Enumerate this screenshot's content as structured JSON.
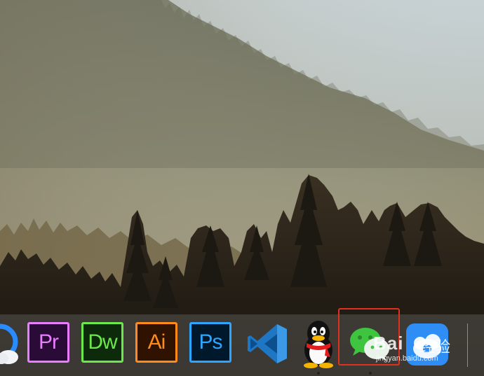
{
  "dock": {
    "apps": [
      {
        "name": "Finder / Cloud",
        "label": ""
      },
      {
        "name": "Adobe Premiere Pro",
        "label": "Pr"
      },
      {
        "name": "Adobe Dreamweaver",
        "label": "Dw"
      },
      {
        "name": "Adobe Illustrator",
        "label": "Ai"
      },
      {
        "name": "Adobe Photoshop",
        "label": "Ps"
      },
      {
        "name": "Visual Studio Code",
        "label": ""
      },
      {
        "name": "QQ",
        "label": ""
      },
      {
        "name": "WeChat",
        "label": ""
      },
      {
        "name": "Baidu Netdisk",
        "label": ""
      }
    ],
    "highlighted_app": "WeChat"
  },
  "watermark": {
    "text": "Bai",
    "jingyan": "经验",
    "url": "jingyan.baidu.com"
  },
  "colors": {
    "highlight_border": "#e0301e",
    "pr": "#e77dff",
    "dw": "#6ce84c",
    "ai": "#ff8c1a",
    "ps": "#2ea6ff",
    "wechat": "#3ec43e"
  }
}
